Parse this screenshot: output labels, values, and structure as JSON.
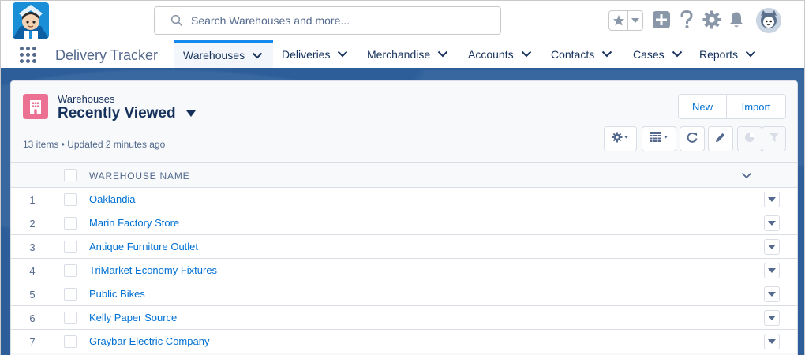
{
  "header": {
    "search_placeholder": "Search Warehouses and more...",
    "accent_color": "#1589ee",
    "icons": [
      "app-logo",
      "search-icon",
      "favorites-star-icon",
      "favorites-menu-icon",
      "global-actions-plus-icon",
      "help-icon",
      "setup-gear-icon",
      "notifications-bell-icon",
      "user-avatar"
    ]
  },
  "nav": {
    "app_name": "Delivery Tracker",
    "items": [
      {
        "label": "Warehouses",
        "active": true
      },
      {
        "label": "Deliveries"
      },
      {
        "label": "Merchandise"
      },
      {
        "label": "Accounts"
      },
      {
        "label": "Contacts"
      },
      {
        "label": "Cases"
      },
      {
        "label": "Reports"
      }
    ]
  },
  "list_view": {
    "object_label": "Warehouses",
    "view_name": "Recently Viewed",
    "meta": "13 items • Updated 2 minutes ago",
    "buttons": {
      "new": "New",
      "import": "Import"
    },
    "toolbar_icons": [
      "list-settings-icon",
      "display-as-table-icon",
      "refresh-icon",
      "edit-list-icon",
      "charts-icon",
      "filter-icon"
    ],
    "column_header": "WAREHOUSE NAME",
    "rows": [
      {
        "num": "1",
        "name": "Oaklandia"
      },
      {
        "num": "2",
        "name": "Marin Factory Store"
      },
      {
        "num": "3",
        "name": "Antique Furniture Outlet"
      },
      {
        "num": "4",
        "name": "TriMarket Economy Fixtures"
      },
      {
        "num": "5",
        "name": "Public Bikes"
      },
      {
        "num": "6",
        "name": "Kelly Paper Source"
      },
      {
        "num": "7",
        "name": "Graybar Electric Company"
      }
    ]
  }
}
